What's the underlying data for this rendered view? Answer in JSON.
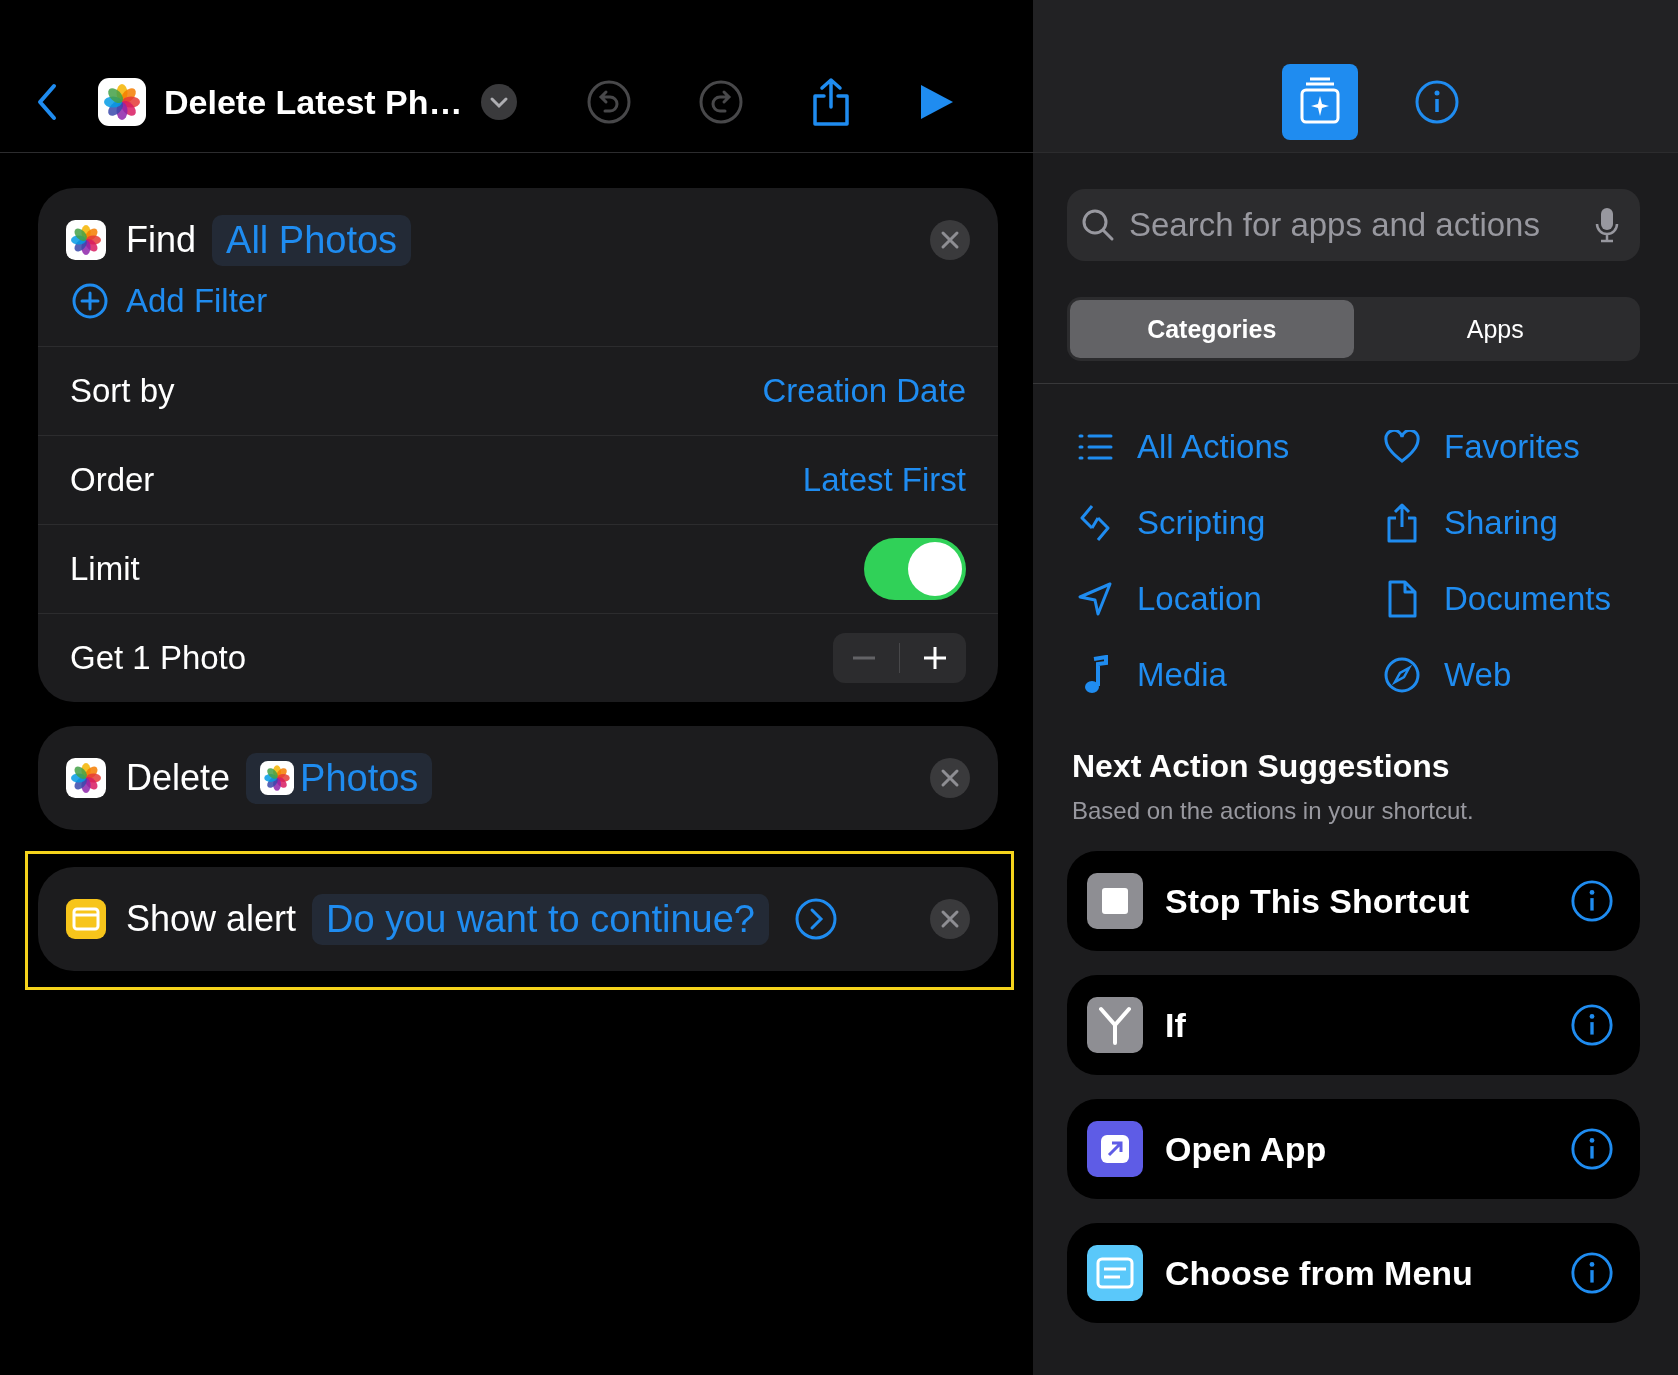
{
  "editor": {
    "title": "Delete Latest Ph…",
    "actions": [
      {
        "kind": "find",
        "verb": "Find",
        "param": "All Photos",
        "add_filter": "Add Filter",
        "highlighted": false,
        "rows": [
          {
            "kind": "value",
            "label": "Sort by",
            "value": "Creation Date"
          },
          {
            "kind": "value",
            "label": "Order",
            "value": "Latest First"
          },
          {
            "kind": "toggle",
            "label": "Limit",
            "on": true
          },
          {
            "kind": "stepper",
            "label": "Get 1 Photo"
          }
        ]
      },
      {
        "kind": "delete",
        "verb": "Delete",
        "param": "Photos",
        "highlighted": false
      },
      {
        "kind": "alert",
        "verb": "Show alert",
        "param": "Do you want to continue?",
        "highlighted": true
      }
    ]
  },
  "library": {
    "search": {
      "placeholder": "Search for apps and actions"
    },
    "tabs": [
      {
        "label": "Categories",
        "selected": true
      },
      {
        "label": "Apps",
        "selected": false
      }
    ],
    "categories": [
      {
        "label": "All Actions"
      },
      {
        "label": "Favorites"
      },
      {
        "label": "Scripting"
      },
      {
        "label": "Sharing"
      },
      {
        "label": "Location"
      },
      {
        "label": "Documents"
      },
      {
        "label": "Media"
      },
      {
        "label": "Web"
      }
    ],
    "suggestions_title": "Next Action Suggestions",
    "suggestions_subtitle": "Based on the actions in your shortcut.",
    "suggestions": [
      {
        "label": "Stop This Shortcut",
        "color": "#8e8e93"
      },
      {
        "label": "If",
        "color": "#8e8e93"
      },
      {
        "label": "Open App",
        "color": "#5e5ce6"
      },
      {
        "label": "Choose from Menu",
        "color": "#5ac8fa"
      }
    ]
  }
}
